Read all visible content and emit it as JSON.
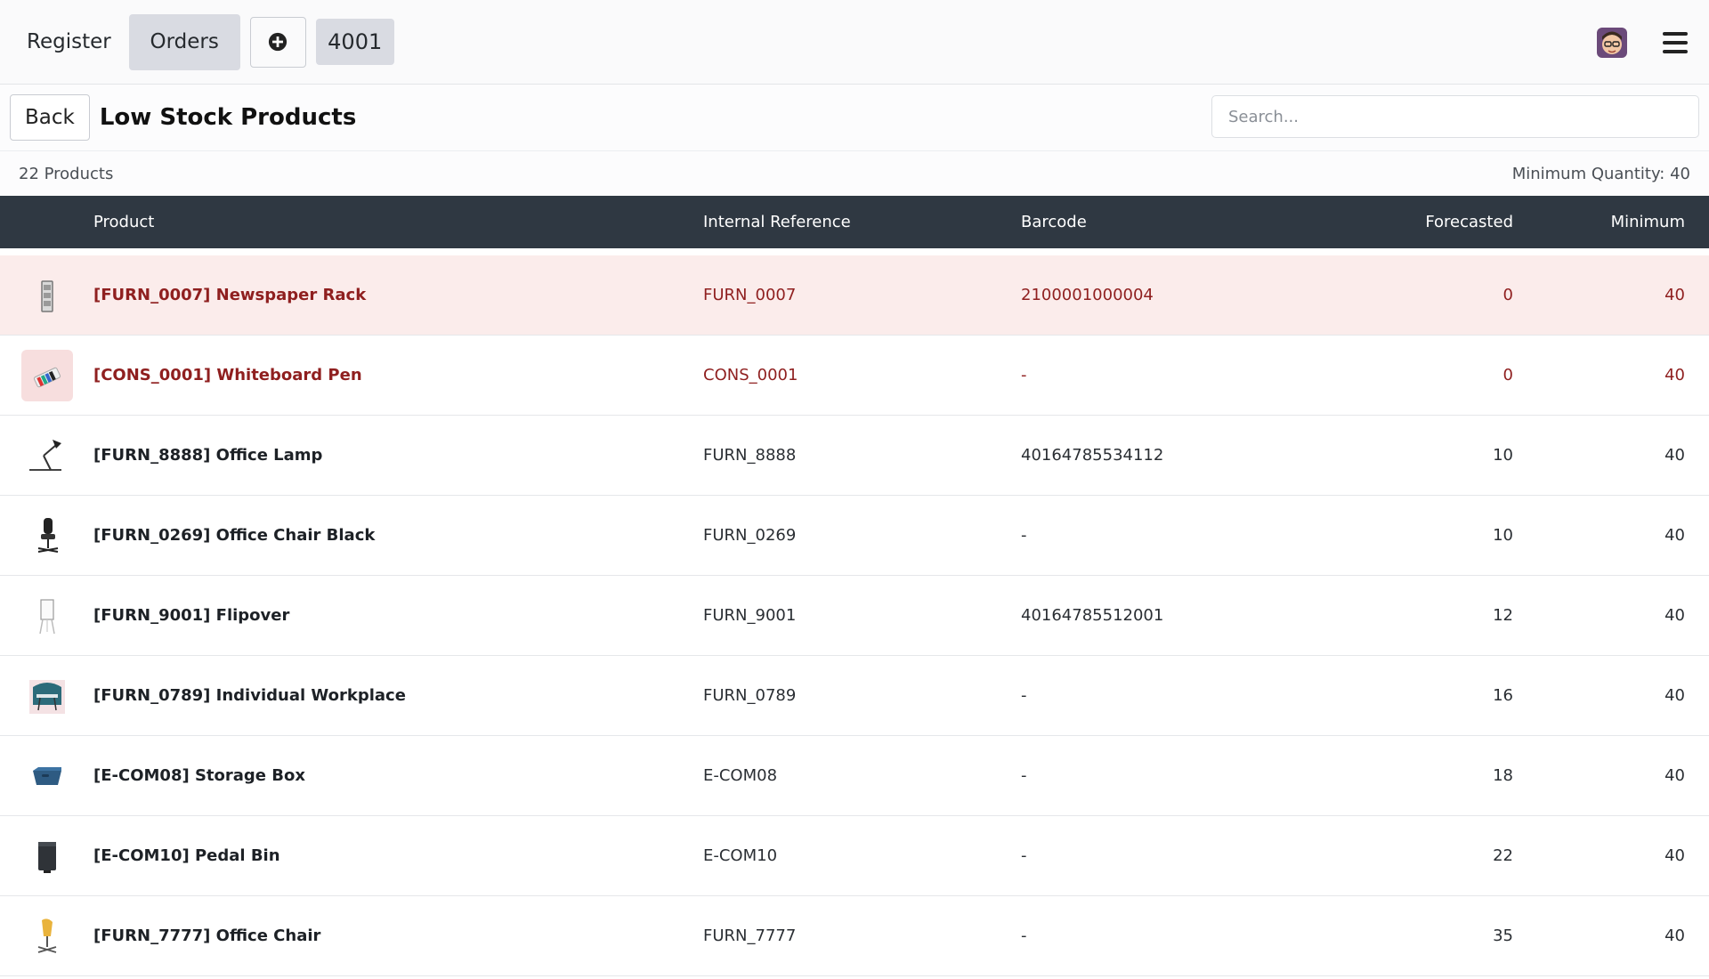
{
  "navbar": {
    "register_label": "Register",
    "orders_label": "Orders",
    "order_number": "4001"
  },
  "controls": {
    "back_label": "Back",
    "title": "Low Stock Products",
    "search_placeholder": "Search..."
  },
  "summary": {
    "count_text": "22 Products",
    "min_qty_text": "Minimum Quantity: 40"
  },
  "table": {
    "headers": {
      "product": "Product",
      "internal_reference": "Internal Reference",
      "barcode": "Barcode",
      "forecasted": "Forecasted",
      "minimum": "Minimum"
    },
    "rows": [
      {
        "product": "[FURN_0007] Newspaper Rack",
        "ref": "FURN_0007",
        "barcode": "2100001000004",
        "forecasted": "0",
        "minimum": "40",
        "icon": "newspaper-rack-icon"
      },
      {
        "product": "[CONS_0001] Whiteboard Pen",
        "ref": "CONS_0001",
        "barcode": "-",
        "forecasted": "0",
        "minimum": "40",
        "icon": "whiteboard-pen-icon"
      },
      {
        "product": "[FURN_8888] Office Lamp",
        "ref": "FURN_8888",
        "barcode": "40164785534112",
        "forecasted": "10",
        "minimum": "40",
        "icon": "office-lamp-icon"
      },
      {
        "product": "[FURN_0269] Office Chair Black",
        "ref": "FURN_0269",
        "barcode": "-",
        "forecasted": "10",
        "minimum": "40",
        "icon": "office-chair-black-icon"
      },
      {
        "product": "[FURN_9001] Flipover",
        "ref": "FURN_9001",
        "barcode": "40164785512001",
        "forecasted": "12",
        "minimum": "40",
        "icon": "flipover-icon"
      },
      {
        "product": "[FURN_0789] Individual Workplace",
        "ref": "FURN_0789",
        "barcode": "-",
        "forecasted": "16",
        "minimum": "40",
        "icon": "workplace-icon"
      },
      {
        "product": "[E-COM08] Storage Box",
        "ref": "E-COM08",
        "barcode": "-",
        "forecasted": "18",
        "minimum": "40",
        "icon": "storage-box-icon"
      },
      {
        "product": "[E-COM10] Pedal Bin",
        "ref": "E-COM10",
        "barcode": "-",
        "forecasted": "22",
        "minimum": "40",
        "icon": "pedal-bin-icon"
      },
      {
        "product": "[FURN_7777] Office Chair",
        "ref": "FURN_7777",
        "barcode": "-",
        "forecasted": "35",
        "minimum": "40",
        "icon": "office-chair-icon"
      }
    ]
  },
  "colors": {
    "header_bg": "#2f3842",
    "alert_text": "#8f1f1f",
    "alert_row_bg": "#fbeceb"
  }
}
